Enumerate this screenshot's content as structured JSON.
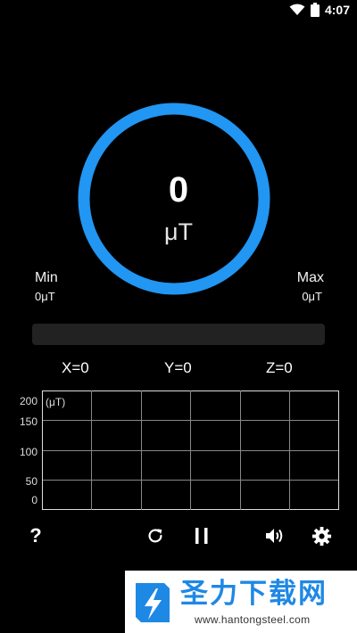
{
  "status_bar": {
    "time": "4:07",
    "icons": [
      "wifi-icon",
      "battery-icon"
    ]
  },
  "gauge": {
    "value": "0",
    "unit": "μT",
    "level_fraction": 0,
    "accent_color": "#2196f3"
  },
  "min": {
    "label": "Min",
    "value": "0μT"
  },
  "max": {
    "label": "Max",
    "value": "0μT"
  },
  "axes": {
    "x": "X=0",
    "y": "Y=0",
    "z": "Z=0"
  },
  "graph": {
    "unit_label": "(μT)",
    "y_ticks": [
      "200",
      "150",
      "100",
      "50",
      "0"
    ],
    "y_tick_values": [
      200,
      150,
      100,
      50,
      0
    ]
  },
  "toolbar": {
    "help_label": "?",
    "icons": [
      "help-icon",
      "refresh-icon",
      "pause-icon",
      "volume-icon",
      "settings-icon"
    ]
  },
  "banner": {
    "title": "圣力下载网",
    "url": "www.hantongsteel.com"
  }
}
